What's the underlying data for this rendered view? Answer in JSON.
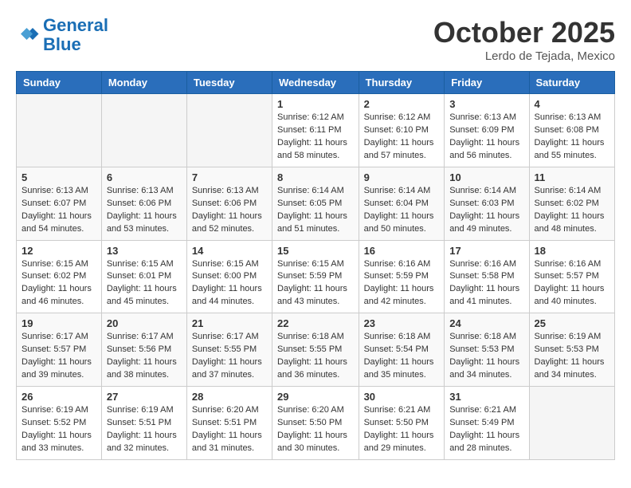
{
  "header": {
    "logo_line1": "General",
    "logo_line2": "Blue",
    "month": "October 2025",
    "location": "Lerdo de Tejada, Mexico"
  },
  "weekdays": [
    "Sunday",
    "Monday",
    "Tuesday",
    "Wednesday",
    "Thursday",
    "Friday",
    "Saturday"
  ],
  "weeks": [
    [
      {
        "day": "",
        "sunrise": "",
        "sunset": "",
        "daylight": ""
      },
      {
        "day": "",
        "sunrise": "",
        "sunset": "",
        "daylight": ""
      },
      {
        "day": "",
        "sunrise": "",
        "sunset": "",
        "daylight": ""
      },
      {
        "day": "1",
        "sunrise": "Sunrise: 6:12 AM",
        "sunset": "Sunset: 6:11 PM",
        "daylight": "Daylight: 11 hours and 58 minutes."
      },
      {
        "day": "2",
        "sunrise": "Sunrise: 6:12 AM",
        "sunset": "Sunset: 6:10 PM",
        "daylight": "Daylight: 11 hours and 57 minutes."
      },
      {
        "day": "3",
        "sunrise": "Sunrise: 6:13 AM",
        "sunset": "Sunset: 6:09 PM",
        "daylight": "Daylight: 11 hours and 56 minutes."
      },
      {
        "day": "4",
        "sunrise": "Sunrise: 6:13 AM",
        "sunset": "Sunset: 6:08 PM",
        "daylight": "Daylight: 11 hours and 55 minutes."
      }
    ],
    [
      {
        "day": "5",
        "sunrise": "Sunrise: 6:13 AM",
        "sunset": "Sunset: 6:07 PM",
        "daylight": "Daylight: 11 hours and 54 minutes."
      },
      {
        "day": "6",
        "sunrise": "Sunrise: 6:13 AM",
        "sunset": "Sunset: 6:06 PM",
        "daylight": "Daylight: 11 hours and 53 minutes."
      },
      {
        "day": "7",
        "sunrise": "Sunrise: 6:13 AM",
        "sunset": "Sunset: 6:06 PM",
        "daylight": "Daylight: 11 hours and 52 minutes."
      },
      {
        "day": "8",
        "sunrise": "Sunrise: 6:14 AM",
        "sunset": "Sunset: 6:05 PM",
        "daylight": "Daylight: 11 hours and 51 minutes."
      },
      {
        "day": "9",
        "sunrise": "Sunrise: 6:14 AM",
        "sunset": "Sunset: 6:04 PM",
        "daylight": "Daylight: 11 hours and 50 minutes."
      },
      {
        "day": "10",
        "sunrise": "Sunrise: 6:14 AM",
        "sunset": "Sunset: 6:03 PM",
        "daylight": "Daylight: 11 hours and 49 minutes."
      },
      {
        "day": "11",
        "sunrise": "Sunrise: 6:14 AM",
        "sunset": "Sunset: 6:02 PM",
        "daylight": "Daylight: 11 hours and 48 minutes."
      }
    ],
    [
      {
        "day": "12",
        "sunrise": "Sunrise: 6:15 AM",
        "sunset": "Sunset: 6:02 PM",
        "daylight": "Daylight: 11 hours and 46 minutes."
      },
      {
        "day": "13",
        "sunrise": "Sunrise: 6:15 AM",
        "sunset": "Sunset: 6:01 PM",
        "daylight": "Daylight: 11 hours and 45 minutes."
      },
      {
        "day": "14",
        "sunrise": "Sunrise: 6:15 AM",
        "sunset": "Sunset: 6:00 PM",
        "daylight": "Daylight: 11 hours and 44 minutes."
      },
      {
        "day": "15",
        "sunrise": "Sunrise: 6:15 AM",
        "sunset": "Sunset: 5:59 PM",
        "daylight": "Daylight: 11 hours and 43 minutes."
      },
      {
        "day": "16",
        "sunrise": "Sunrise: 6:16 AM",
        "sunset": "Sunset: 5:59 PM",
        "daylight": "Daylight: 11 hours and 42 minutes."
      },
      {
        "day": "17",
        "sunrise": "Sunrise: 6:16 AM",
        "sunset": "Sunset: 5:58 PM",
        "daylight": "Daylight: 11 hours and 41 minutes."
      },
      {
        "day": "18",
        "sunrise": "Sunrise: 6:16 AM",
        "sunset": "Sunset: 5:57 PM",
        "daylight": "Daylight: 11 hours and 40 minutes."
      }
    ],
    [
      {
        "day": "19",
        "sunrise": "Sunrise: 6:17 AM",
        "sunset": "Sunset: 5:57 PM",
        "daylight": "Daylight: 11 hours and 39 minutes."
      },
      {
        "day": "20",
        "sunrise": "Sunrise: 6:17 AM",
        "sunset": "Sunset: 5:56 PM",
        "daylight": "Daylight: 11 hours and 38 minutes."
      },
      {
        "day": "21",
        "sunrise": "Sunrise: 6:17 AM",
        "sunset": "Sunset: 5:55 PM",
        "daylight": "Daylight: 11 hours and 37 minutes."
      },
      {
        "day": "22",
        "sunrise": "Sunrise: 6:18 AM",
        "sunset": "Sunset: 5:55 PM",
        "daylight": "Daylight: 11 hours and 36 minutes."
      },
      {
        "day": "23",
        "sunrise": "Sunrise: 6:18 AM",
        "sunset": "Sunset: 5:54 PM",
        "daylight": "Daylight: 11 hours and 35 minutes."
      },
      {
        "day": "24",
        "sunrise": "Sunrise: 6:18 AM",
        "sunset": "Sunset: 5:53 PM",
        "daylight": "Daylight: 11 hours and 34 minutes."
      },
      {
        "day": "25",
        "sunrise": "Sunrise: 6:19 AM",
        "sunset": "Sunset: 5:53 PM",
        "daylight": "Daylight: 11 hours and 34 minutes."
      }
    ],
    [
      {
        "day": "26",
        "sunrise": "Sunrise: 6:19 AM",
        "sunset": "Sunset: 5:52 PM",
        "daylight": "Daylight: 11 hours and 33 minutes."
      },
      {
        "day": "27",
        "sunrise": "Sunrise: 6:19 AM",
        "sunset": "Sunset: 5:51 PM",
        "daylight": "Daylight: 11 hours and 32 minutes."
      },
      {
        "day": "28",
        "sunrise": "Sunrise: 6:20 AM",
        "sunset": "Sunset: 5:51 PM",
        "daylight": "Daylight: 11 hours and 31 minutes."
      },
      {
        "day": "29",
        "sunrise": "Sunrise: 6:20 AM",
        "sunset": "Sunset: 5:50 PM",
        "daylight": "Daylight: 11 hours and 30 minutes."
      },
      {
        "day": "30",
        "sunrise": "Sunrise: 6:21 AM",
        "sunset": "Sunset: 5:50 PM",
        "daylight": "Daylight: 11 hours and 29 minutes."
      },
      {
        "day": "31",
        "sunrise": "Sunrise: 6:21 AM",
        "sunset": "Sunset: 5:49 PM",
        "daylight": "Daylight: 11 hours and 28 minutes."
      },
      {
        "day": "",
        "sunrise": "",
        "sunset": "",
        "daylight": ""
      }
    ]
  ]
}
